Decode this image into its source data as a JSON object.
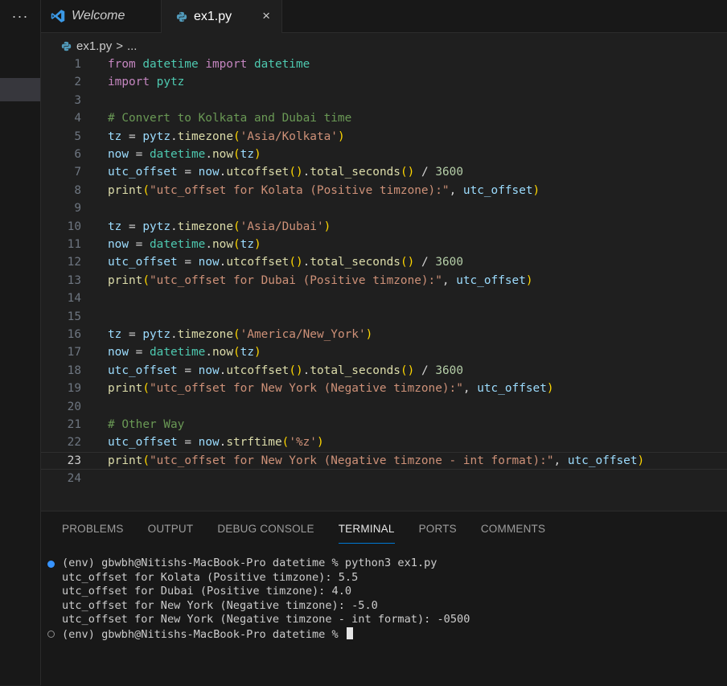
{
  "tabs": {
    "welcome_label": "Welcome",
    "file_label": "ex1.py",
    "close_glyph": "×",
    "more_glyph": "···"
  },
  "breadcrumb": {
    "file": "ex1.py",
    "separator": ">",
    "more": "..."
  },
  "editor": {
    "current_line": 23,
    "lines": [
      {
        "n": "1",
        "t": "from datetime import datetime"
      },
      {
        "n": "2",
        "t": "import pytz"
      },
      {
        "n": "3",
        "t": ""
      },
      {
        "n": "4",
        "t": "# Convert to Kolkata and Dubai time"
      },
      {
        "n": "5",
        "t": "tz = pytz.timezone('Asia/Kolkata')"
      },
      {
        "n": "6",
        "t": "now = datetime.now(tz)"
      },
      {
        "n": "7",
        "t": "utc_offset = now.utcoffset().total_seconds() / 3600"
      },
      {
        "n": "8",
        "t": "print(\"utc_offset for Kolata (Positive timzone):\", utc_offset)"
      },
      {
        "n": "9",
        "t": ""
      },
      {
        "n": "10",
        "t": "tz = pytz.timezone('Asia/Dubai')"
      },
      {
        "n": "11",
        "t": "now = datetime.now(tz)"
      },
      {
        "n": "12",
        "t": "utc_offset = now.utcoffset().total_seconds() / 3600"
      },
      {
        "n": "13",
        "t": "print(\"utc_offset for Dubai (Positive timzone):\", utc_offset)"
      },
      {
        "n": "14",
        "t": ""
      },
      {
        "n": "15",
        "t": ""
      },
      {
        "n": "16",
        "t": "tz = pytz.timezone('America/New_York')"
      },
      {
        "n": "17",
        "t": "now = datetime.now(tz)"
      },
      {
        "n": "18",
        "t": "utc_offset = now.utcoffset().total_seconds() / 3600"
      },
      {
        "n": "19",
        "t": "print(\"utc_offset for New York (Negative timzone):\", utc_offset)"
      },
      {
        "n": "20",
        "t": ""
      },
      {
        "n": "21",
        "t": "# Other Way"
      },
      {
        "n": "22",
        "t": "utc_offset = now.strftime('%z')"
      },
      {
        "n": "23",
        "t": "print(\"utc_offset for New York (Negative timzone - int format):\", utc_offset)"
      },
      {
        "n": "24",
        "t": ""
      }
    ]
  },
  "panel": {
    "tabs": [
      "PROBLEMS",
      "OUTPUT",
      "DEBUG CONSOLE",
      "TERMINAL",
      "PORTS",
      "COMMENTS"
    ],
    "active_tab": "TERMINAL"
  },
  "terminal": {
    "lines": [
      "(env) gbwbh@Nitishs-MacBook-Pro datetime % python3 ex1.py",
      "utc_offset for Kolata (Positive timzone): 5.5",
      "utc_offset for Dubai (Positive timzone): 4.0",
      "utc_offset for New York (Negative timzone): -5.0",
      "utc_offset for New York (Negative timzone - int format): -0500",
      "(env) gbwbh@Nitishs-MacBook-Pro datetime % "
    ]
  },
  "colors": {
    "background": "#1f1f1f",
    "accent": "#0078d4",
    "python_icon": "#519aba",
    "vscode_icon": "#3b99e6"
  }
}
